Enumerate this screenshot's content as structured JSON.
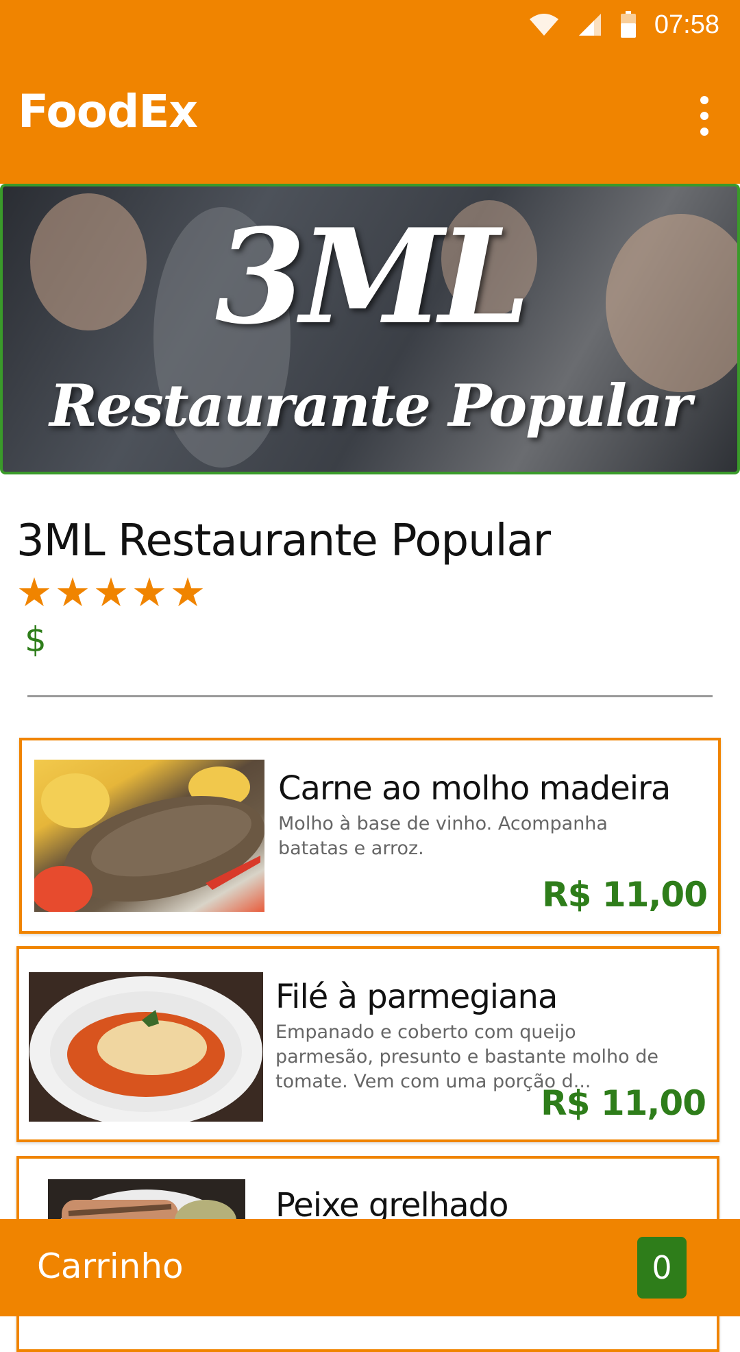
{
  "status_bar": {
    "time": "07:58",
    "icons": [
      "wifi-icon",
      "signal-icon",
      "battery-icon"
    ]
  },
  "app_bar": {
    "title": "FoodEx",
    "menu_icon": "more-vert-icon"
  },
  "banner": {
    "logo_line1": "3ML",
    "logo_line2": "Restaurante Popular"
  },
  "restaurant": {
    "name": "3ML Restaurante Popular",
    "rating": 5,
    "rating_max": 5,
    "price_level": "$"
  },
  "menu_items": [
    {
      "name": "Carne ao molho madeira",
      "description": "Molho à base de vinho. Acompanha batatas e arroz.",
      "price": "R$ 11,00"
    },
    {
      "name": "Filé à parmegiana",
      "description": "Empanado e coberto com queijo parmesão, presunto e bastante molho de tomate. Vem com uma porção d...",
      "price": "R$ 11,00"
    },
    {
      "name": "Peixe grelhado",
      "description": "",
      "price": ""
    }
  ],
  "cart": {
    "label": "Carrinho",
    "count": "0"
  },
  "colors": {
    "primary": "#f08400",
    "accent_green": "#2e7d1a",
    "banner_border": "#3a9a2a",
    "text_dark": "#111111",
    "text_muted": "#666666"
  }
}
